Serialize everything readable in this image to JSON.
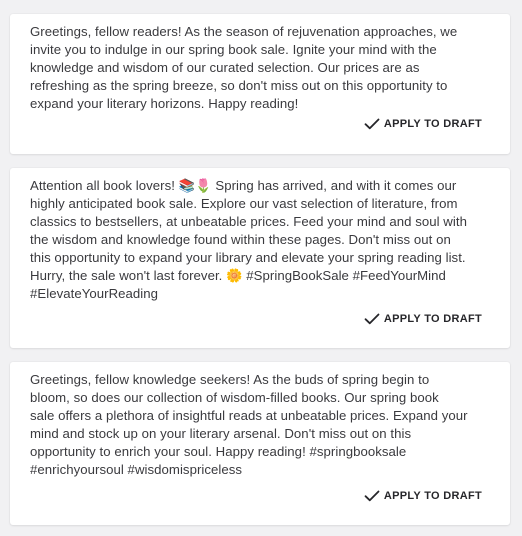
{
  "posts": [
    {
      "text": "Greetings, fellow readers! As the season of rejuvenation approaches, we\ninvite you to indulge in our spring book sale. Ignite your mind with the\nknowledge and wisdom of our curated selection. Our prices are as\nrefreshing as the spring breeze, so don't miss out on this opportunity to\nexpand your literary horizons. Happy reading!",
      "action_label": "APPLY TO DRAFT",
      "action_icon": "check-icon"
    },
    {
      "text": "Attention all book lovers! 📚🌷 Spring has arrived, and with it comes our\nhighly anticipated book sale. Explore our vast selection of literature, from\nclassics to bestsellers, at unbeatable prices. Feed your mind and soul with\nthe wisdom and knowledge found within these pages. Don't miss out on\nthis opportunity to expand your library and elevate your spring reading list.\nHurry, the sale won't last forever. 🌼 #SpringBookSale #FeedYourMind\n#ElevateYourReading",
      "action_label": "APPLY TO DRAFT",
      "action_icon": "check-icon"
    },
    {
      "text": "Greetings, fellow knowledge seekers! As the buds of spring begin to\nbloom, so does our collection of wisdom-filled books. Our spring book\nsale offers a plethora of insightful reads at unbeatable prices. Expand your\nmind and stock up on your literary arsenal. Don't miss out on this\nopportunity to enrich your soul. Happy reading! #springbooksale\n#enrichyoursoul #wisdomispriceless",
      "action_label": "APPLY TO DRAFT",
      "action_icon": "check-icon"
    }
  ],
  "colors": {
    "background": "#f1f1f3",
    "card": "#ffffff",
    "text": "#3a3a3e",
    "action": "#26262a"
  }
}
